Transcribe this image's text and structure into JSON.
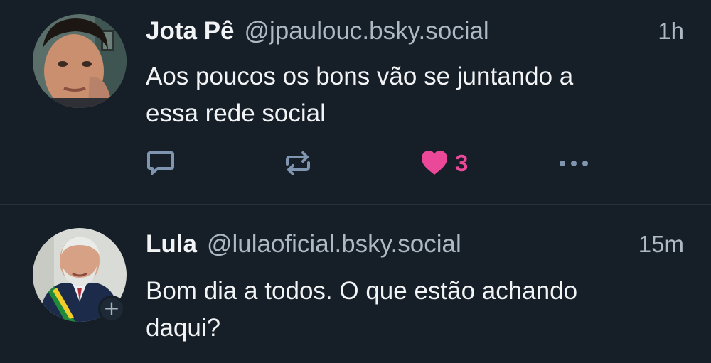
{
  "posts": [
    {
      "display_name": "Jota Pê",
      "handle": "@jpaulouc.bsky.social",
      "time": "1h",
      "text_lines": [
        "Aos poucos os bons vão se juntando a",
        "essa rede social"
      ],
      "like_count": "3",
      "liked": true
    },
    {
      "display_name": "Lula",
      "handle": "@lulaoficial.bsky.social",
      "time": "15m",
      "text_lines": [
        "Bom dia a todos. O que estão achando",
        "daqui?"
      ]
    }
  ],
  "colors": {
    "background": "#161e27",
    "text": "#f1f3f5",
    "muted": "#aeb9c6",
    "icon": "#7f95b0",
    "like": "#ec4899"
  },
  "icons": {
    "reply": "reply-icon",
    "repost": "repost-icon",
    "like": "heart-icon",
    "more": "more-icon",
    "follow": "plus-icon"
  },
  "follow_badge_symbol": "+"
}
